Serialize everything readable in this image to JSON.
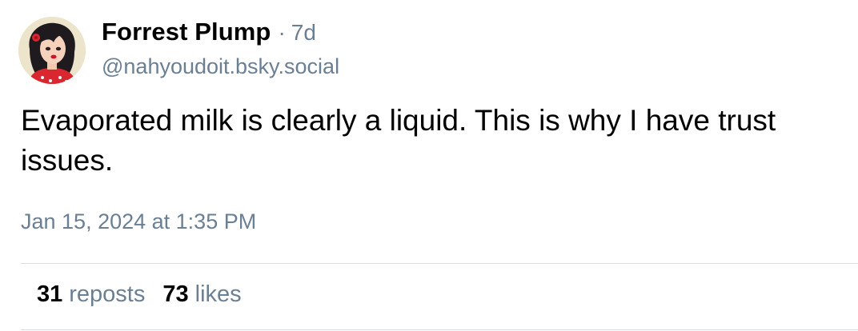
{
  "author": {
    "display_name": "Forrest Plump",
    "separator": "·",
    "age": "7d",
    "handle": "@nahyoudoit.bsky.social"
  },
  "post": {
    "text": "Evaporated milk is clearly a liquid. This is why I have trust issues.",
    "timestamp": "Jan 15, 2024 at 1:35 PM"
  },
  "stats": {
    "reposts_count": "31",
    "reposts_label": "reposts",
    "likes_count": "73",
    "likes_label": "likes"
  },
  "colors": {
    "secondary_text": "#6b7f93",
    "divider": "#d9dee4"
  }
}
